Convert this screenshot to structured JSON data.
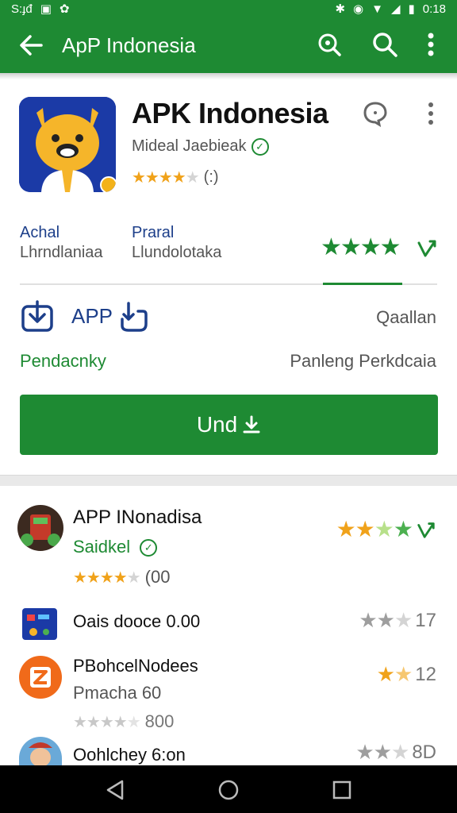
{
  "status_bar": {
    "left_text": "S:ɟđ",
    "time": "0:18"
  },
  "app_bar": {
    "title": "ApP Indonesia"
  },
  "app": {
    "title": "APK Indonesia",
    "developer": "Mideal Jaebieak",
    "rating_text": "(:)",
    "rating": 4.5
  },
  "info": {
    "col1_key": "Achal",
    "col1_value": "Lhrndlaniaa",
    "col2_key": "Praral",
    "col2_value": "Llundolotaka"
  },
  "actions": {
    "app_label": "APP",
    "quality_label": "Qaallan",
    "pending_left": "Pendacnky",
    "pending_right": "Panleng Perkdcaia",
    "install_label": "Und"
  },
  "list": [
    {
      "title": "APP INonadisa",
      "subtitle": "Saidkel",
      "rating_text": "(00",
      "right_value": ""
    },
    {
      "title": "Oais dooce 0.00",
      "right_value": "17"
    },
    {
      "title": "PBohcelNodees",
      "subtitle": "Pmacha  60",
      "rating_text": "800",
      "right_value": "12"
    },
    {
      "title": "Oohlchey 6:on",
      "right_value": "8D"
    }
  ],
  "colors": {
    "primary": "#1e8a33",
    "link_blue": "#1d3f8a",
    "star": "#f0a21a"
  }
}
